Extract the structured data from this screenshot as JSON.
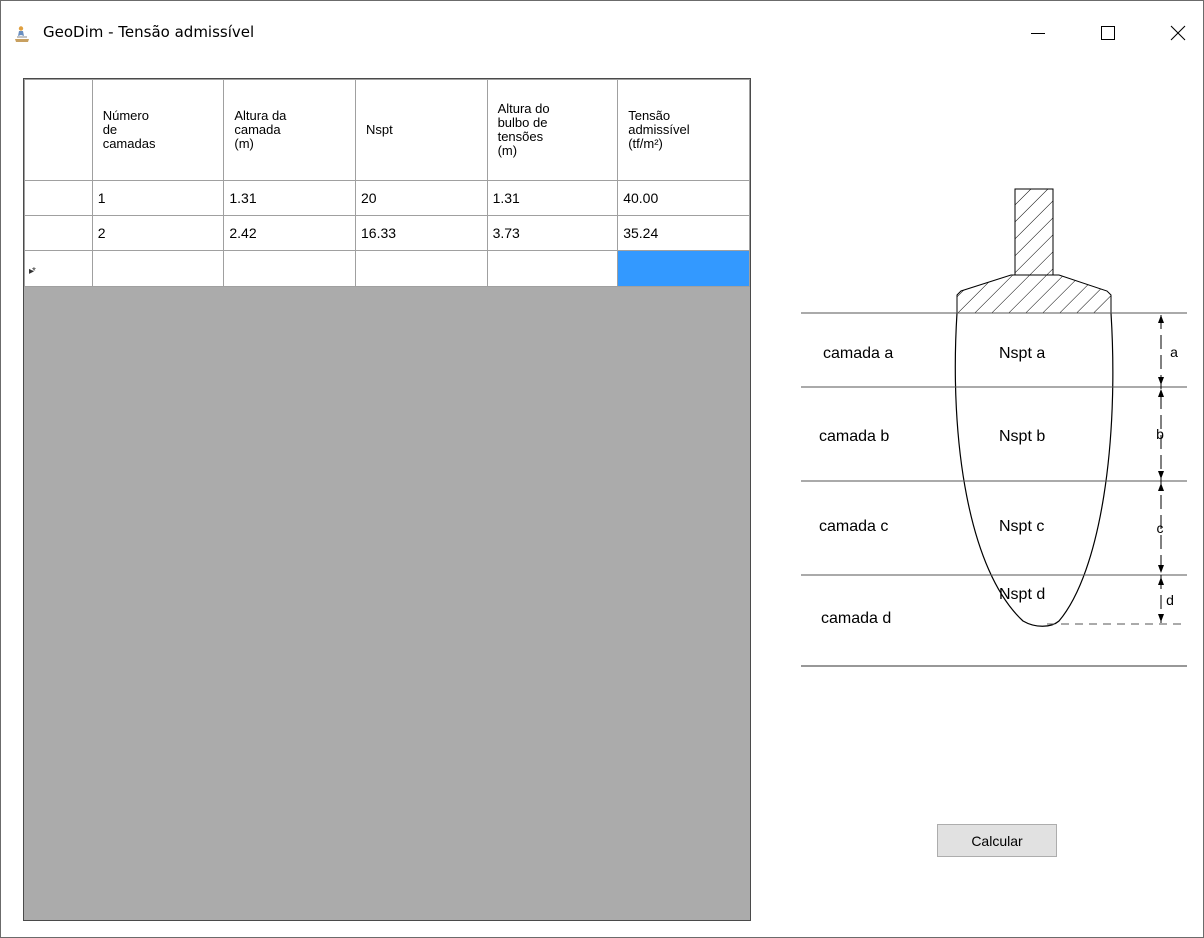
{
  "window": {
    "title": "GeoDim - Tensão admissível"
  },
  "grid": {
    "columns": [
      "Número\nde\ncamadas",
      "Altura da\ncamada\n(m)",
      "Nspt",
      "Altura do\nbulbo de\ntensões\n(m)",
      "Tensão\nadmissível\n(tf/m²)"
    ],
    "rows": [
      [
        "1",
        "1.31",
        "20",
        "1.31",
        "40.00"
      ],
      [
        "2",
        "2.42",
        "16.33",
        "3.73",
        "35.24"
      ]
    ],
    "new_row_marker": "▸*",
    "selected_color": "#3399ff",
    "background_color": "#ababab"
  },
  "diagram": {
    "layers": [
      {
        "label": "camada a",
        "nspt": "Nspt a",
        "dim": "a"
      },
      {
        "label": "camada b",
        "nspt": "Nspt b",
        "dim": "b"
      },
      {
        "label": "camada c",
        "nspt": "Nspt c",
        "dim": "c"
      },
      {
        "label": "camada d",
        "nspt": "Nspt d",
        "dim": "d"
      }
    ]
  },
  "actions": {
    "calculate_label": "Calcular"
  }
}
